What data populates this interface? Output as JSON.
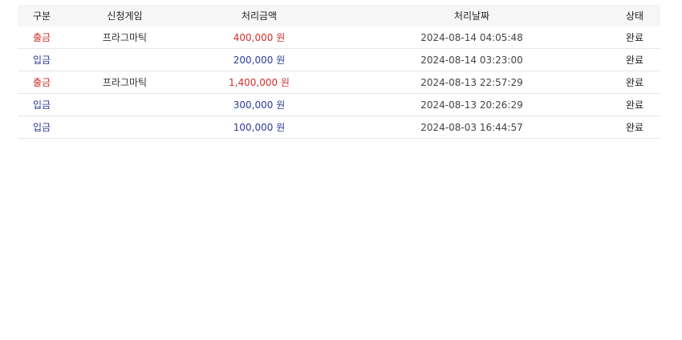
{
  "table": {
    "headers": {
      "type": "구분",
      "game": "신청게임",
      "amount": "처리금액",
      "date": "처리날짜",
      "status": "상태"
    },
    "rows": [
      {
        "type": "출금",
        "kind": "withdraw",
        "game": "프라그마틱",
        "amount": "400,000 원",
        "date": "2024-08-14 04:05:48",
        "status": "완료"
      },
      {
        "type": "입금",
        "kind": "deposit",
        "game": "",
        "amount": "200,000 원",
        "date": "2024-08-14 03:23:00",
        "status": "완료"
      },
      {
        "type": "출금",
        "kind": "withdraw",
        "game": "프라그마틱",
        "amount": "1,400,000 원",
        "date": "2024-08-13 22:57:29",
        "status": "완료"
      },
      {
        "type": "입금",
        "kind": "deposit",
        "game": "",
        "amount": "300,000 원",
        "date": "2024-08-13 20:26:29",
        "status": "완료"
      },
      {
        "type": "입금",
        "kind": "deposit",
        "game": "",
        "amount": "100,000 원",
        "date": "2024-08-03 16:44:57",
        "status": "완료"
      }
    ]
  },
  "colors": {
    "withdraw": "#d32f2f",
    "deposit": "#2c3a9a",
    "header_bg": "#f6f6f6",
    "row_border": "#e6e6e6"
  }
}
